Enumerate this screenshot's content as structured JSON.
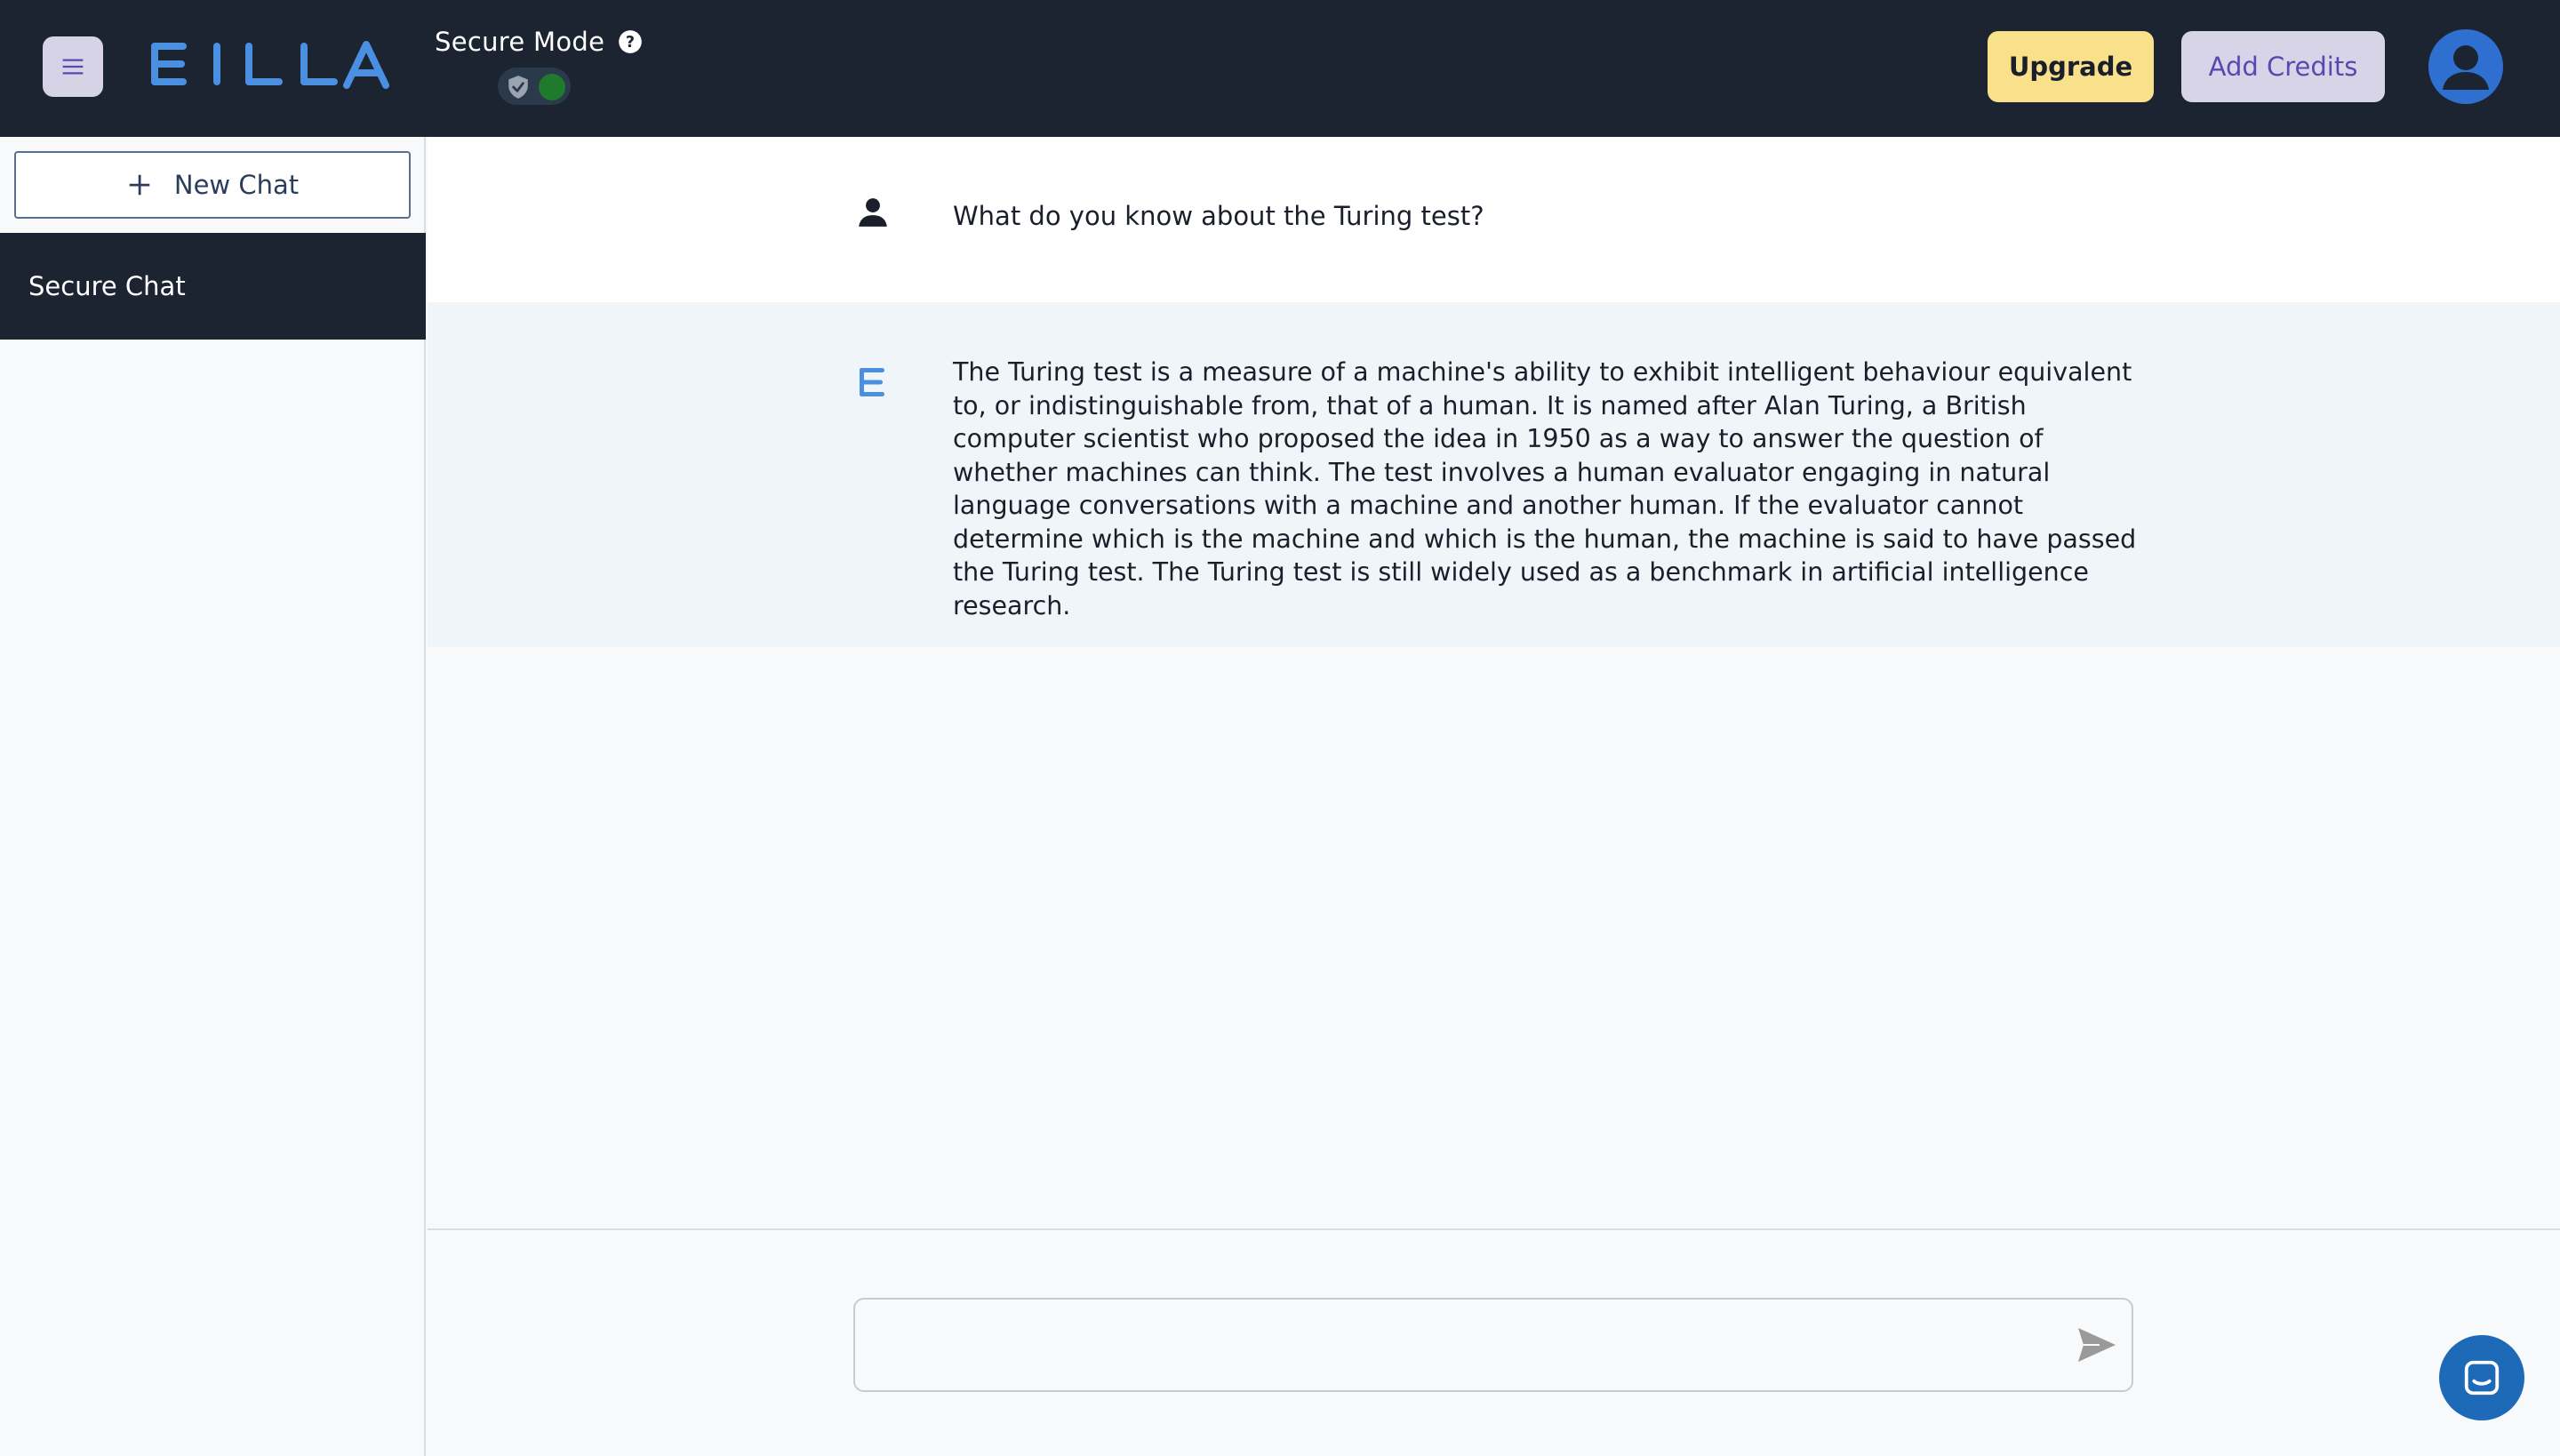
{
  "header": {
    "menu_icon": "hamburger-icon",
    "logo_text": "EILLA",
    "secure_mode_label": "Secure Mode",
    "help_icon": "question-circle-icon",
    "secure_toggle": {
      "state": "on",
      "icon": "shield-check-icon"
    },
    "upgrade_label": "Upgrade",
    "add_credits_label": "Add Credits",
    "avatar_icon": "user-avatar-icon"
  },
  "sidebar": {
    "new_chat_label": "New Chat",
    "chats": [
      {
        "label": "Secure Chat",
        "active": true
      }
    ]
  },
  "conversation": {
    "messages": [
      {
        "role": "user",
        "icon": "person-icon",
        "text": "What do you know about the Turing test?"
      },
      {
        "role": "assistant",
        "icon": "eilla-e-icon",
        "text": "The Turing test is a measure of a machine's ability to exhibit intelligent behaviour equivalent to, or indistinguishable from, that of a human. It is named after Alan Turing, a British computer scientist who proposed the idea in 1950 as a way to answer the question of whether machines can think. The test involves a human evaluator engaging in natural language conversations with a machine and another human. If the evaluator cannot determine which is the machine and which is the human, the machine is said to have passed the Turing test. The Turing test is still widely used as a benchmark in artificial intelligence research."
      }
    ]
  },
  "composer": {
    "value": "",
    "placeholder": "",
    "send_icon": "send-icon"
  },
  "support": {
    "icon": "chat-launcher-icon"
  },
  "colors": {
    "header_bg": "#1b2430",
    "logo_blue": "#4a8fe0",
    "upgrade_bg": "#f9e08a",
    "credits_bg": "#d8d4e8",
    "credits_text": "#5b47b0",
    "avatar_bg": "#2f6fd0",
    "assistant_bg": "#f0f5fa",
    "toggle_on": "#1f7a2c"
  }
}
